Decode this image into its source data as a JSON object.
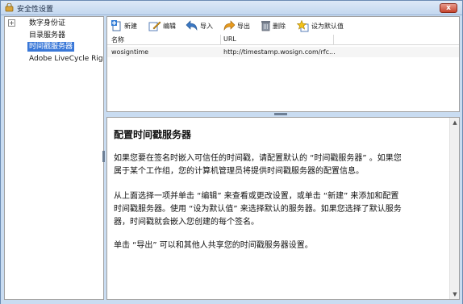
{
  "window": {
    "title": "安全性设置",
    "close_label": "x"
  },
  "tree": {
    "items": [
      {
        "label": "数字身份证",
        "expander": "+"
      },
      {
        "label": "目录服务器"
      },
      {
        "label": "时间戳服务器",
        "selected": true
      },
      {
        "label": "Adobe LiveCycle Rights Management 服务器"
      }
    ]
  },
  "toolbar": {
    "new_label": "新建",
    "edit_label": "编辑",
    "import_label": "导入",
    "export_label": "导出",
    "delete_label": "删除",
    "set_default_label": "设为默认值"
  },
  "list": {
    "columns": [
      "名称",
      "URL"
    ],
    "rows": [
      {
        "name": "wosigntime",
        "url": "http://timestamp.wosign.com/rfc..."
      }
    ]
  },
  "description": {
    "title": "配置时间戳服务器",
    "p1_line1": "如果您要在签名时嵌入可信任的时间戳，请配置默认的 “时间戳服务器” 。如果您",
    "p1_line2": "属于某个工作组，您的计算机管理员将提供时间戳服务器的配置信息。",
    "p2_line1": "从上面选择一项并单击 “编辑” 来查看或更改设置，或单击 “新建” 来添加和配置",
    "p2_line2": "时间戳服务器。使用 “设为默认值” 来选择默认的服务器。如果您选择了默认服务",
    "p2_line3": "器，时间戳就会嵌入您创建的每个签名。",
    "p3_line1": "单击 “导出” 可以和其他人共享您的时间戳服务器设置。"
  }
}
